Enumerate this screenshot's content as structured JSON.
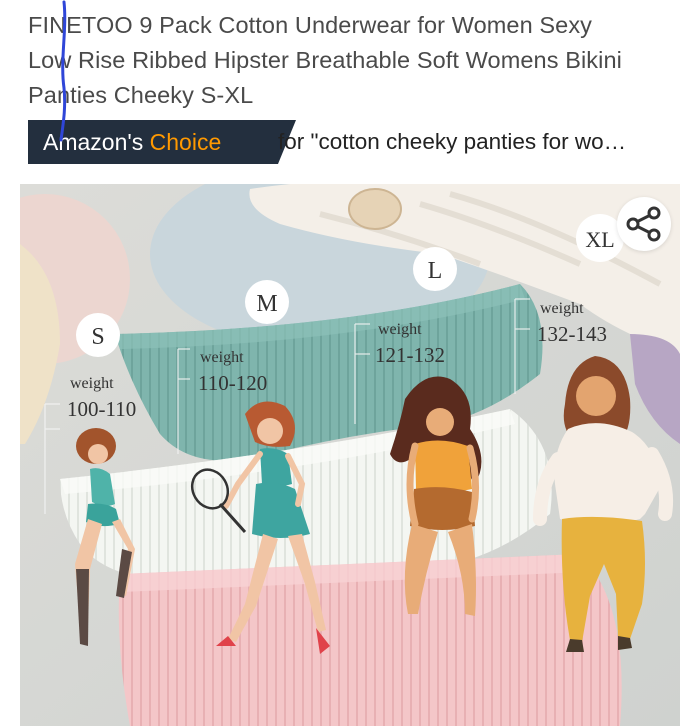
{
  "product": {
    "title_line1": "FINETOO 9 Pack Cotton Underwear for Women Sexy",
    "title_line2": "Low Rise Ribbed Hipster Breathable Soft Womens Bikini",
    "title_line3": "Panties Cheeky S-XL"
  },
  "badge": {
    "label_main": "Amazon's",
    "label_accent": "Choice",
    "query_text": "for \"cotton cheeky panties for wo…",
    "accent_color": "#ff9900",
    "badge_color": "#232f3e"
  },
  "image": {
    "sizes": [
      {
        "size": "S",
        "label": "weight",
        "range": "100-110"
      },
      {
        "size": "M",
        "label": "weight",
        "range": "110-120"
      },
      {
        "size": "L",
        "label": "weight",
        "range": "121-132"
      },
      {
        "size": "XL",
        "label": "weight",
        "range": "132-143"
      }
    ],
    "colors": {
      "teal": "#7fb5ad",
      "white": "#f4f6f2",
      "pink": "#f4c6c8"
    }
  },
  "share": {
    "icon": "share-icon"
  }
}
